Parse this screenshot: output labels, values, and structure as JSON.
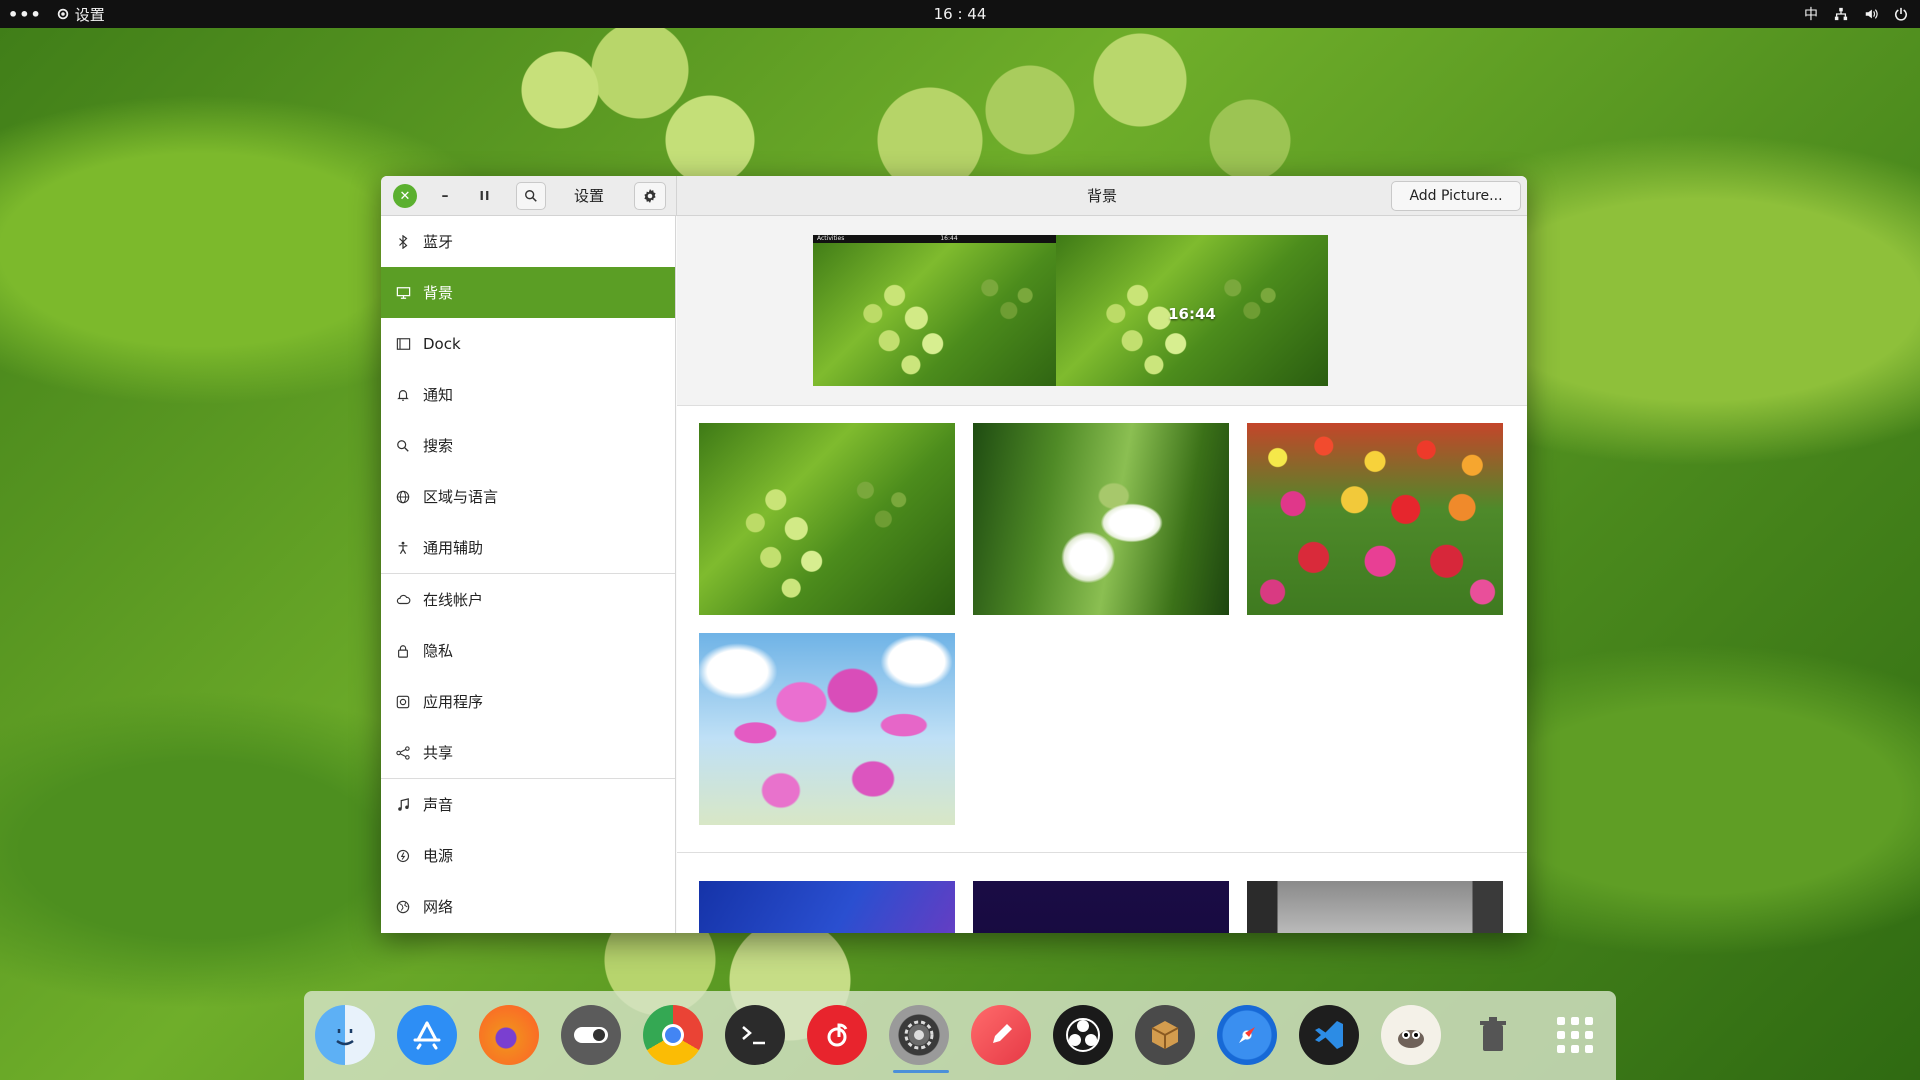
{
  "topbar": {
    "activities": "•••",
    "app_name": "设置",
    "clock": "16 : 44",
    "input_method": "中"
  },
  "window": {
    "sidebar_title": "设置",
    "title": "背景",
    "add_picture": "Add Picture...",
    "lock_preview_time": "16:44",
    "mini_bar_left": "Activities",
    "mini_bar_clock": "16:44"
  },
  "sidebar": {
    "items": [
      {
        "label": "蓝牙",
        "icon": "bluetooth-icon"
      },
      {
        "label": "背景",
        "icon": "display-icon",
        "active": true
      },
      {
        "label": "Dock",
        "icon": "dock-icon"
      },
      {
        "label": "通知",
        "icon": "bell-icon"
      },
      {
        "label": "搜索",
        "icon": "search-icon"
      },
      {
        "label": "区域与语言",
        "icon": "globe-icon"
      },
      {
        "label": "通用辅助",
        "icon": "accessibility-icon"
      },
      {
        "label": "在线帐户",
        "icon": "cloud-icon"
      },
      {
        "label": "隐私",
        "icon": "lock-icon"
      },
      {
        "label": "应用程序",
        "icon": "apps-icon"
      },
      {
        "label": "共享",
        "icon": "share-icon"
      },
      {
        "label": "声音",
        "icon": "music-icon"
      },
      {
        "label": "电源",
        "icon": "power-icon"
      },
      {
        "label": "网络",
        "icon": "network-icon"
      }
    ]
  },
  "wallpapers": [
    "grapes",
    "snowdrop",
    "tulips-field",
    "pink-tulips",
    "blue-abstract",
    "dark-purple",
    "black-white-building"
  ],
  "dock": {
    "apps": [
      "finder",
      "app-store",
      "firefox",
      "toggle-tweaks",
      "chrome",
      "terminal",
      "music-163",
      "settings",
      "pencil-editor",
      "obs",
      "package-manager",
      "safari",
      "vscode",
      "gimp",
      "trash",
      "app-grid"
    ],
    "active": "settings"
  },
  "colors": {
    "accent": "#5b9e25",
    "close_button": "#5bb02f",
    "dock_indicator": "#4a90d9"
  }
}
